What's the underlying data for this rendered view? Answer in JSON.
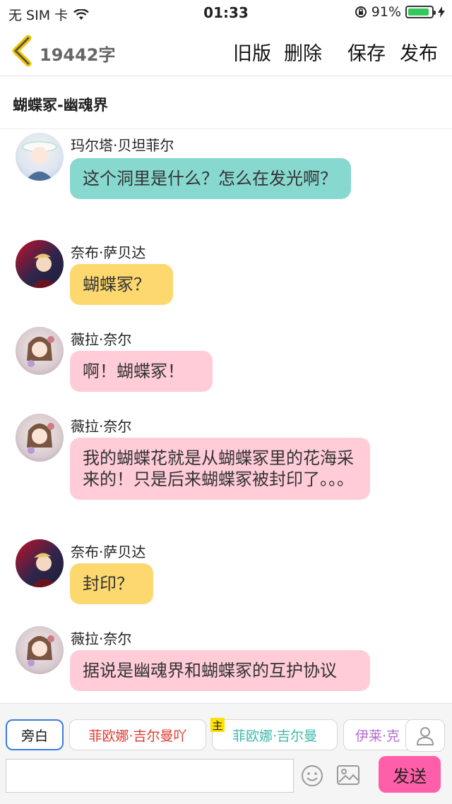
{
  "status_bar": {
    "carrier": "无 SIM 卡",
    "time": "01:33",
    "battery": "91%",
    "battery_level": 0.91
  },
  "nav": {
    "word_count": "19442字",
    "old_version": "旧版",
    "delete": "删除",
    "save": "保存",
    "publish": "发布"
  },
  "chapter_title": "蝴蝶冢-幽魂界",
  "messages": [
    {
      "name": "玛尔塔·贝坦菲尔",
      "text": "这个洞里是什么？怎么在发光啊？",
      "color": "#87d8cf"
    },
    {
      "name": "奈布·萨贝达",
      "text": "蝴蝶冢？",
      "color": "#fdd86e"
    },
    {
      "name": "薇拉·奈尔",
      "text": "啊！蝴蝶冢！",
      "color": "#ffccd8"
    },
    {
      "name": "薇拉·奈尔",
      "text": "我的蝴蝶花就是从蝴蝶冢里的花海采来的！只是后来蝴蝶冢被封印了。。。",
      "color": "#ffccd8"
    },
    {
      "name": "奈布·萨贝达",
      "text": "封印？",
      "color": "#fdd86e"
    },
    {
      "name": "薇拉·奈尔",
      "text": "据说是幽魂界和蝴蝶冢的互护协议",
      "color": "#ffccd8"
    }
  ],
  "roles": {
    "narration": "旁白",
    "role1": "菲欧娜·吉尔曼吖",
    "role2": "菲欧娜·吉尔曼",
    "role3": "伊莱·克",
    "main_tag": "主"
  },
  "input": {
    "placeholder": "",
    "send": "发送"
  },
  "icons": {
    "back": "chevron-left-icon",
    "person": "person-icon",
    "emoji": "smiley-icon",
    "image": "image-icon"
  }
}
